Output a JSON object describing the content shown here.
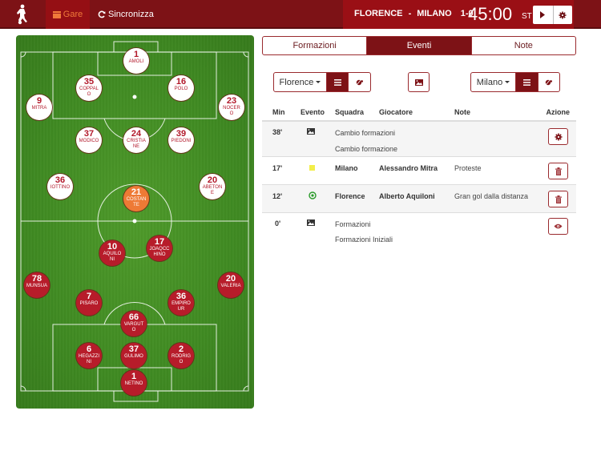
{
  "topbar": {
    "logo_icon": "soccer-player-icon",
    "nav": [
      {
        "label": "Gare",
        "icon": "calendar-icon",
        "active": true
      },
      {
        "label": "Sincronizza",
        "icon": "refresh-icon",
        "active": false
      }
    ],
    "match": {
      "home": "FLORENCE",
      "separator": "-",
      "away": "MILANO",
      "score": "1-0",
      "time": "45:00",
      "period": "ST"
    },
    "buttons": [
      {
        "icon": "play-icon"
      },
      {
        "icon": "gear-icon"
      }
    ]
  },
  "field": {
    "home_team": [
      {
        "number": "1",
        "name": "AMOLI"
      },
      {
        "number": "35",
        "name": "COPPALO"
      },
      {
        "number": "16",
        "name": "POLO"
      },
      {
        "number": "9",
        "name": "MITRA"
      },
      {
        "number": "23",
        "name": "NOCERO"
      },
      {
        "number": "37",
        "name": "MODICO"
      },
      {
        "number": "24",
        "name": "CRISTIANE"
      },
      {
        "number": "39",
        "name": "PIEDONI"
      },
      {
        "number": "36",
        "name": "IOTTINO"
      },
      {
        "number": "20",
        "name": "ABETONE"
      }
    ],
    "selected_player": {
      "number": "21",
      "name": "COSTANTE"
    },
    "away_team": [
      {
        "number": "10",
        "name": "AQUILONI"
      },
      {
        "number": "17",
        "name": "JOAQCCHINO"
      },
      {
        "number": "78",
        "name": "MUNSUA"
      },
      {
        "number": "20",
        "name": "VALERIA"
      },
      {
        "number": "7",
        "name": "PISARO"
      },
      {
        "number": "36",
        "name": "EMPIROUR"
      },
      {
        "number": "66",
        "name": "VARGUTO"
      },
      {
        "number": "6",
        "name": "HEGAZZINI"
      },
      {
        "number": "37",
        "name": "GULIMO"
      },
      {
        "number": "2",
        "name": "RODRIGO"
      },
      {
        "number": "1",
        "name": "NETINO"
      }
    ]
  },
  "tabs": [
    {
      "label": "Formazioni",
      "active": false
    },
    {
      "label": "Eventi",
      "active": true
    },
    {
      "label": "Note",
      "active": false
    }
  ],
  "controls": {
    "home_team_select": "Florence",
    "away_team_select": "Milano",
    "list_icon": "list-icon",
    "whistle_icon": "whistle-icon",
    "image_icon": "image-icon"
  },
  "events_table": {
    "headers": [
      "Min",
      "Evento",
      "Squadra",
      "Giocatore",
      "Note",
      "Azione"
    ],
    "rows": [
      {
        "min": "38'",
        "event_icon": "image-icon",
        "line1": "Cambio formazioni",
        "line2": "Cambio formazione",
        "team": "",
        "player": "",
        "note": "",
        "action_icon": "gear-icon"
      },
      {
        "min": "17'",
        "event_icon": "yellow-card-icon",
        "team": "Milano",
        "player": "Alessandro Mitra",
        "note": "Proteste",
        "action_icon": "trash-icon"
      },
      {
        "min": "12'",
        "event_icon": "goal-icon",
        "team": "Florence",
        "player": "Alberto Aquiloni",
        "note": "Gran gol dalla distanza",
        "action_icon": "trash-icon"
      },
      {
        "min": "0'",
        "event_icon": "image-icon",
        "line1": "Formazioni",
        "line2": "Formazioni Iniziali",
        "team": "",
        "player": "",
        "note": "",
        "action_icon": "eye-icon"
      }
    ]
  },
  "colors": {
    "brand": "#7d1216",
    "accent": "#ee7a35",
    "away_player": "#b71c2a",
    "home_player_text": "#b2182a",
    "yellow_card": "#f2ee4a",
    "goal": "#2a9a2a"
  }
}
